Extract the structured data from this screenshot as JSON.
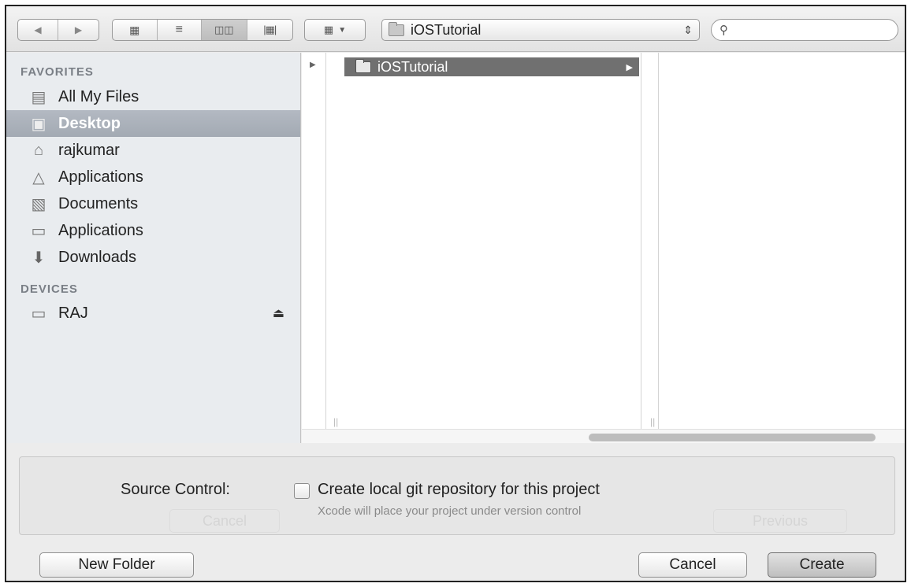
{
  "toolbar": {
    "back_icon": "back-arrow-icon",
    "forward_icon": "forward-arrow-icon",
    "view_modes": [
      "icon-view-icon",
      "list-view-icon",
      "column-view-icon",
      "coverflow-view-icon"
    ],
    "active_view": "column-view-icon",
    "arrange_icon": "arrange-icon",
    "path_popup_label": "iOSTutorial",
    "search_placeholder": ""
  },
  "sidebar": {
    "favorites_header": "FAVORITES",
    "favorites": [
      {
        "label": "All My Files",
        "icon": "all-files-icon"
      },
      {
        "label": "Desktop",
        "icon": "desktop-icon",
        "selected": true
      },
      {
        "label": "rajkumar",
        "icon": "home-icon"
      },
      {
        "label": "Applications",
        "icon": "applications-icon"
      },
      {
        "label": "Documents",
        "icon": "documents-icon"
      },
      {
        "label": "Applications",
        "icon": "folder-icon"
      },
      {
        "label": "Downloads",
        "icon": "downloads-icon"
      }
    ],
    "devices_header": "DEVICES",
    "devices": [
      {
        "label": "RAJ",
        "icon": "disk-icon",
        "eject_icon": "eject-icon"
      }
    ]
  },
  "browser": {
    "column1_item": {
      "label": "iOSTutorial",
      "selected": true,
      "has_children": true
    }
  },
  "options": {
    "source_control_label": "Source Control:",
    "checkbox_checked": false,
    "checkbox_label": "Create local git repository for this project",
    "checkbox_description": "Xcode will place your project under version control",
    "ghost_cancel": "Cancel",
    "ghost_previous": "Previous"
  },
  "buttons": {
    "new_folder": "New Folder",
    "cancel": "Cancel",
    "create": "Create"
  },
  "colors": {
    "selection_sidebar": "#a9b0b9",
    "selection_column": "#707070",
    "window_background": "#ececec"
  }
}
